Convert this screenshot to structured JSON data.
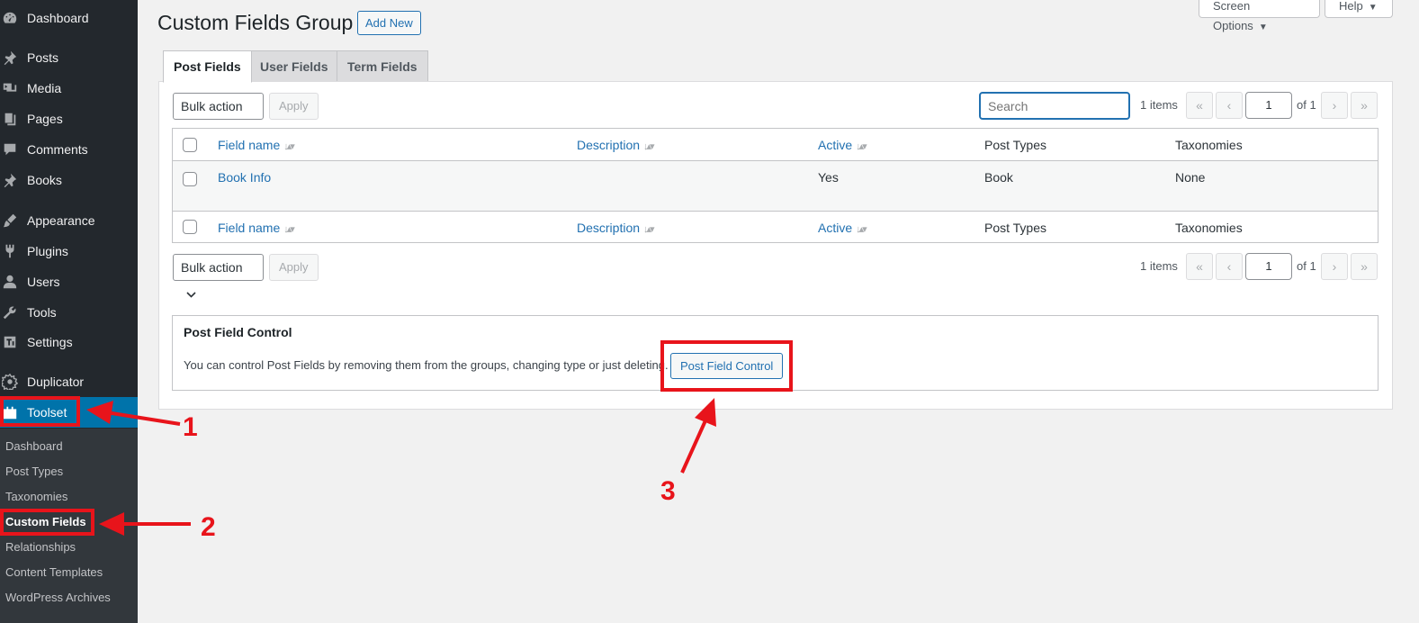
{
  "sidebar": {
    "items": [
      {
        "label": "Dashboard",
        "icon": "dashboard-icon"
      },
      {
        "label": "Posts",
        "icon": "pin-icon"
      },
      {
        "label": "Media",
        "icon": "media-icon"
      },
      {
        "label": "Pages",
        "icon": "pages-icon"
      },
      {
        "label": "Comments",
        "icon": "comments-icon"
      },
      {
        "label": "Books",
        "icon": "pin-icon"
      },
      {
        "label": "Appearance",
        "icon": "brush-icon"
      },
      {
        "label": "Plugins",
        "icon": "plugin-icon"
      },
      {
        "label": "Users",
        "icon": "users-icon"
      },
      {
        "label": "Tools",
        "icon": "wrench-icon"
      },
      {
        "label": "Settings",
        "icon": "settings-icon"
      },
      {
        "label": "Duplicator",
        "icon": "duplicator-icon"
      },
      {
        "label": "Toolset",
        "icon": "toolset-icon"
      }
    ],
    "submenu": [
      "Dashboard",
      "Post Types",
      "Taxonomies",
      "Custom Fields",
      "Relationships",
      "Content Templates",
      "WordPress Archives"
    ],
    "accent_color": "#0073aa"
  },
  "header": {
    "title": "Custom Fields Group",
    "add_new": "Add New",
    "screen_options": "Screen Options",
    "help": "Help"
  },
  "tabs": [
    "Post Fields",
    "User Fields",
    "Term Fields"
  ],
  "toolbar": {
    "bulk_action": "Bulk action",
    "apply": "Apply",
    "search_placeholder": "Search",
    "items_count": "1 items",
    "page_current": "1",
    "page_of": "of 1",
    "first": "«",
    "prev": "‹",
    "next": "›",
    "last": "»"
  },
  "table": {
    "columns": [
      "Field name",
      "Description",
      "Active",
      "Post Types",
      "Taxonomies"
    ],
    "rows": [
      {
        "field_name": "Book Info",
        "description": "",
        "active": "Yes",
        "post_types": "Book",
        "taxonomies": "None"
      }
    ]
  },
  "control": {
    "title": "Post Field Control",
    "description": "You can control Post Fields by removing them from the groups, changing type or just deleting.",
    "button": "Post Field Control"
  },
  "annotations": {
    "labels": [
      "1",
      "2",
      "3"
    ],
    "color": "#e8141b"
  }
}
